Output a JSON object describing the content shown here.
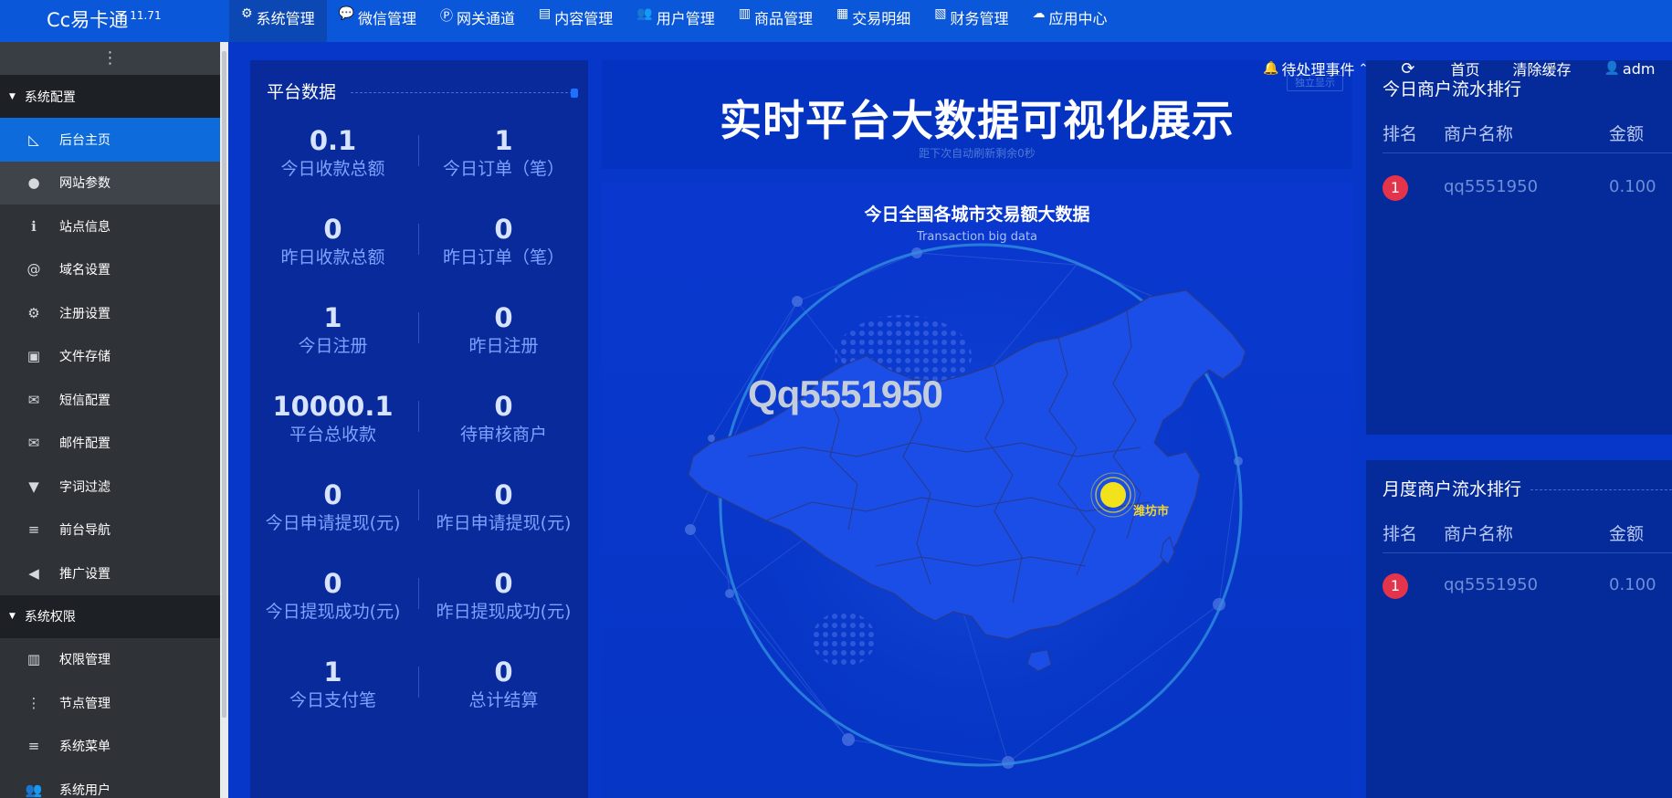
{
  "brand": {
    "name": "Cc易卡通",
    "version": "11.71"
  },
  "topnav": [
    {
      "label": "系统管理",
      "icon": "gear-icon",
      "glyph": "⚙",
      "active": true
    },
    {
      "label": "微信管理",
      "icon": "wechat-icon",
      "glyph": "💬",
      "active": false
    },
    {
      "label": "网关通道",
      "icon": "gateway-icon",
      "glyph": "Ⓟ",
      "active": false
    },
    {
      "label": "内容管理",
      "icon": "document-icon",
      "glyph": "▤",
      "active": false
    },
    {
      "label": "用户管理",
      "icon": "users-icon",
      "glyph": "👥",
      "active": false
    },
    {
      "label": "商品管理",
      "icon": "shopping-bag-icon",
      "glyph": "▥",
      "active": false
    },
    {
      "label": "交易明细",
      "icon": "bar-chart-icon",
      "glyph": "▦",
      "active": false
    },
    {
      "label": "财务管理",
      "icon": "finance-icon",
      "glyph": "▧",
      "active": false
    },
    {
      "label": "应用中心",
      "icon": "cloud-icon",
      "glyph": "☁",
      "active": false
    }
  ],
  "utilbar": {
    "pending": "待处理事件",
    "home": "首页",
    "clear_cache": "清除缓存",
    "user": "adm"
  },
  "sidebar": {
    "toggle": "⋮",
    "groups": [
      {
        "label": "系统配置",
        "items": [
          {
            "label": "后台主页",
            "icon": "area-chart-icon",
            "glyph": "◺",
            "active": true
          },
          {
            "label": "网站参数",
            "icon": "apple-icon",
            "glyph": "●",
            "hovered": true
          },
          {
            "label": "站点信息",
            "icon": "info-icon",
            "glyph": "ℹ"
          },
          {
            "label": "域名设置",
            "icon": "at-icon",
            "glyph": "@"
          },
          {
            "label": "注册设置",
            "icon": "gear-icon",
            "glyph": "⚙"
          },
          {
            "label": "文件存储",
            "icon": "floppy-disk-icon",
            "glyph": "▣"
          },
          {
            "label": "短信配置",
            "icon": "envelope-icon",
            "glyph": "✉"
          },
          {
            "label": "邮件配置",
            "icon": "envelope-icon",
            "glyph": "✉"
          },
          {
            "label": "字词过滤",
            "icon": "filter-icon",
            "glyph": "▼"
          },
          {
            "label": "前台导航",
            "icon": "menu-icon",
            "glyph": "≡"
          },
          {
            "label": "推广设置",
            "icon": "megaphone-icon",
            "glyph": "◀"
          }
        ]
      },
      {
        "label": "系统权限",
        "items": [
          {
            "label": "权限管理",
            "icon": "shopping-bag-icon",
            "glyph": "▥"
          },
          {
            "label": "节点管理",
            "icon": "vertical-ellipsis-icon",
            "glyph": "⋮"
          },
          {
            "label": "系统菜单",
            "icon": "menu-icon",
            "glyph": "≡"
          },
          {
            "label": "系统用户",
            "icon": "users-icon",
            "glyph": "👥"
          }
        ]
      }
    ]
  },
  "stats": {
    "title": "平台数据",
    "rows": [
      [
        {
          "value": "0.1",
          "label": "今日收款总额"
        },
        {
          "value": "1",
          "label": "今日订单（笔）"
        }
      ],
      [
        {
          "value": "0",
          "label": "昨日收款总额"
        },
        {
          "value": "0",
          "label": "昨日订单（笔）"
        }
      ],
      [
        {
          "value": "1",
          "label": "今日注册"
        },
        {
          "value": "0",
          "label": "昨日注册"
        }
      ],
      [
        {
          "value": "10000.1",
          "label": "平台总收款"
        },
        {
          "value": "0",
          "label": "待审核商户"
        }
      ],
      [
        {
          "value": "0",
          "label": "今日申请提现(元)"
        },
        {
          "value": "0",
          "label": "昨日申请提现(元)"
        }
      ],
      [
        {
          "value": "0",
          "label": "今日提现成功(元)"
        },
        {
          "value": "0",
          "label": "昨日提现成功(元)"
        }
      ],
      [
        {
          "value": "1",
          "label": "今日支付笔"
        },
        {
          "value": "0",
          "label": "总计结算"
        }
      ]
    ]
  },
  "banner": {
    "title": "实时平台大数据可视化展示",
    "countdown": "距下次自动刷新剩余0秒",
    "standalone": "独立显示"
  },
  "map": {
    "title": "今日全国各城市交易额大数据",
    "subtitle": "Transaction big data",
    "watermark": "Qq5551950",
    "city": "潍坊市",
    "colors": {
      "land": "#1a4ee6",
      "border": "#2a3a8a",
      "ring": "#2f8ee0",
      "marker": "#f2e21c"
    }
  },
  "rank_today": {
    "title": "今日商户流水排行",
    "columns": [
      "排名",
      "商户名称",
      "金额"
    ],
    "rows": [
      {
        "rank": "1",
        "name": "qq5551950",
        "amount": "0.100"
      }
    ]
  },
  "rank_month": {
    "title": "月度商户流水排行",
    "columns": [
      "排名",
      "商户名称",
      "金额"
    ],
    "rows": [
      {
        "rank": "1",
        "name": "qq5551950",
        "amount": "0.100"
      }
    ]
  }
}
